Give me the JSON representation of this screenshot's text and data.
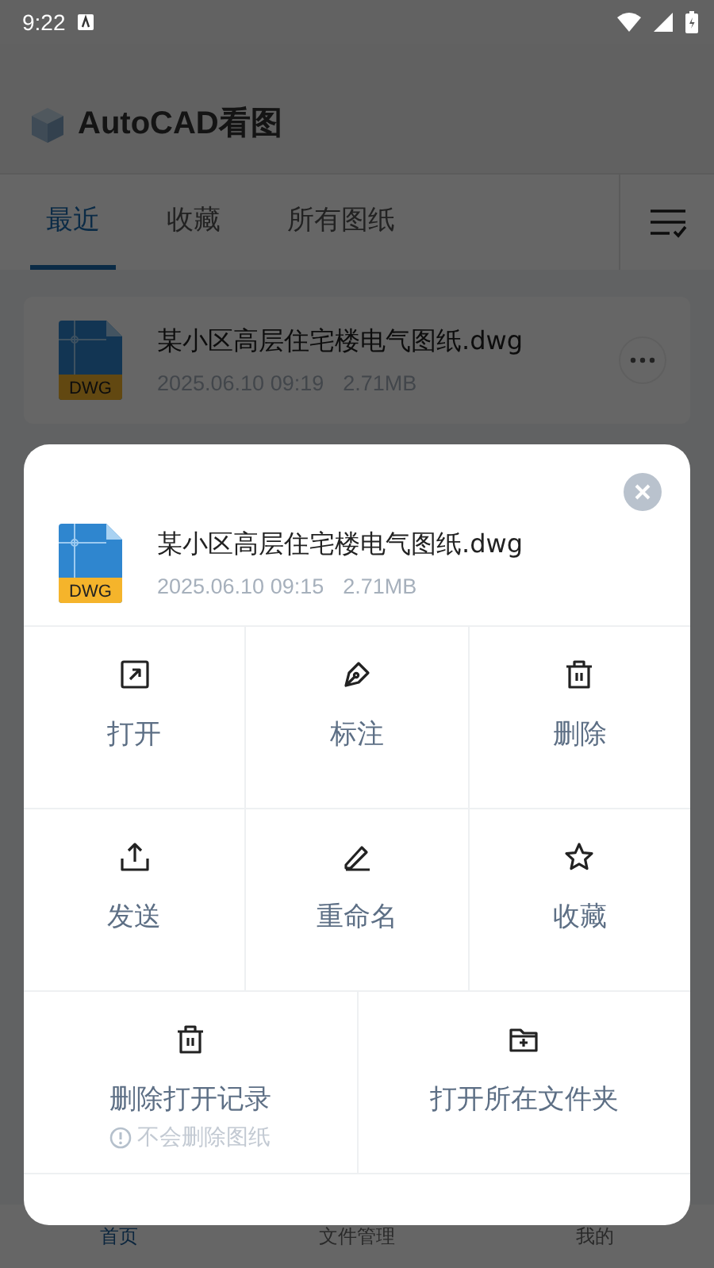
{
  "status_bar": {
    "time": "9:22"
  },
  "app_bar": {
    "title": "AutoCAD看图"
  },
  "tabs": [
    {
      "label": "最近",
      "selected": true
    },
    {
      "label": "收藏",
      "selected": false
    },
    {
      "label": "所有图纸",
      "selected": false
    }
  ],
  "files": [
    {
      "name": "某小区高层住宅楼电气图纸.dwg",
      "date": "2025.06.10 09:19",
      "size": "2.71MB",
      "badge": "DWG"
    }
  ],
  "bottom_nav": [
    {
      "label": "首页",
      "selected": true
    },
    {
      "label": "文件管理",
      "selected": false
    },
    {
      "label": "我的",
      "selected": false
    }
  ],
  "sheet": {
    "file": {
      "name": "某小区高层住宅楼电气图纸.dwg",
      "date": "2025.06.10 09:15",
      "size": "2.71MB",
      "badge": "DWG"
    },
    "action_rows": [
      [
        {
          "kind": "open",
          "label": "打开"
        },
        {
          "kind": "annotate",
          "label": "标注"
        },
        {
          "kind": "delete",
          "label": "删除"
        }
      ],
      [
        {
          "kind": "send",
          "label": "发送"
        },
        {
          "kind": "rename",
          "label": "重命名"
        },
        {
          "kind": "favorite",
          "label": "收藏"
        }
      ],
      [
        {
          "kind": "remove-record",
          "label": "删除打开记录",
          "note": "不会删除图纸"
        },
        {
          "kind": "open-folder",
          "label": "打开所在文件夹"
        }
      ]
    ]
  }
}
